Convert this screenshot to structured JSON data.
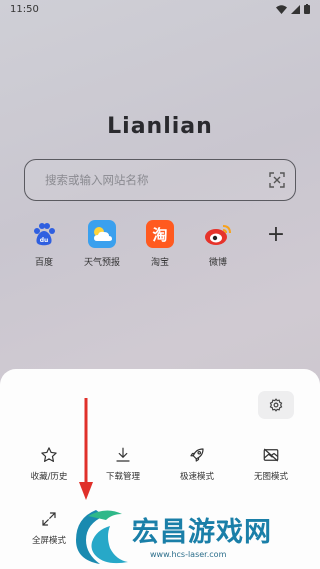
{
  "status_bar": {
    "time": "11:50"
  },
  "logo": {
    "text": "Lianlian"
  },
  "search": {
    "placeholder": "搜索或输入网站名称"
  },
  "shortcuts": [
    {
      "label": "百度",
      "icon": "baidu-icon",
      "color": "#2f5fe0"
    },
    {
      "label": "天气预报",
      "icon": "weather-icon",
      "color": "#3aa0ee"
    },
    {
      "label": "淘宝",
      "icon": "taobao-icon",
      "color": "#ff5a1f"
    },
    {
      "label": "微博",
      "icon": "weibo-icon",
      "color": "#e6332a"
    },
    {
      "label": "",
      "icon": "add-icon",
      "color": "#333333"
    }
  ],
  "menu": {
    "row1": [
      {
        "label": "收藏/历史",
        "icon": "star-icon"
      },
      {
        "label": "下载管理",
        "icon": "download-icon"
      },
      {
        "label": "极速模式",
        "icon": "rocket-icon"
      },
      {
        "label": "无图模式",
        "icon": "no-image-icon"
      }
    ],
    "row2": [
      {
        "label": "全屏模式",
        "icon": "fullscreen-icon"
      }
    ]
  },
  "watermark": {
    "title": "宏昌游戏网",
    "url": "www.hcs-laser.com"
  },
  "colors": {
    "sheet_bg": "#fdfdfd",
    "arrow": "#e0302a",
    "watermark": "#1a7fa8"
  }
}
